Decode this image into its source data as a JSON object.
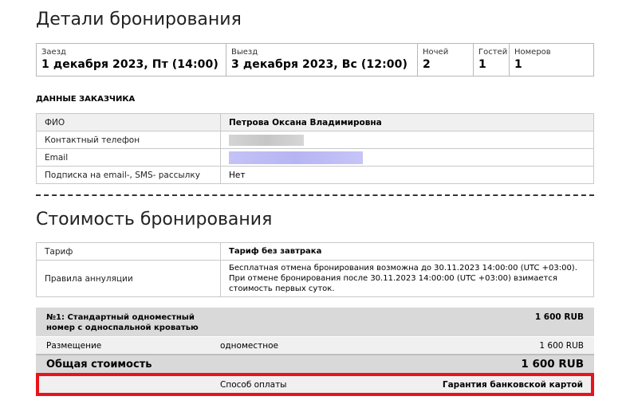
{
  "booking": {
    "title": "Детали бронирования",
    "checkin_label": "Заезд",
    "checkin_value": "1 декабря 2023, Пт (14:00)",
    "checkout_label": "Выезд",
    "checkout_value": "3 декабря 2023, Вс (12:00)",
    "nights_label": "Ночей",
    "nights_value": "2",
    "guests_label": "Гостей",
    "guests_value": "1",
    "rooms_label": "Номеров",
    "rooms_value": "1"
  },
  "customer": {
    "section_title": "ДАННЫЕ ЗАКАЗЧИКА",
    "rows": [
      {
        "label": "ФИО",
        "value": "Петрова Оксана Владимировна"
      },
      {
        "label": "Контактный телефон",
        "value": ""
      },
      {
        "label": "Email",
        "value": ""
      },
      {
        "label": "Подписка на email-, SMS- рассылку",
        "value": "Нет"
      }
    ]
  },
  "cost": {
    "title": "Стоимость бронирования",
    "tariff_label": "Тариф",
    "tariff_value": "Тариф без завтрака",
    "cancel_label": "Правила аннуляции",
    "cancel_value": "Бесплатная отмена бронирования возможна до 30.11.2023 14:00:00 (UTC +03:00). При отмене бронирования после 30.11.2023 14:00:00 (UTC +03:00) взимается стоимость первых суток.",
    "room_title": "№1: Стандартный одноместный номер с односпальной кроватью",
    "room_price": "1 600 RUB",
    "accommodation_label": "Размещение",
    "accommodation_type": "одноместное",
    "accommodation_price": "1 600 RUB",
    "total_label": "Общая стоимость",
    "total_price": "1 600 RUB",
    "payment_label": "Способ оплаты",
    "payment_value": "Гарантия банковской картой"
  },
  "colors": {
    "highlight_border": "#e8141b",
    "email_blur": "#bab7f4",
    "phone_blur": "#cfcfcf"
  }
}
